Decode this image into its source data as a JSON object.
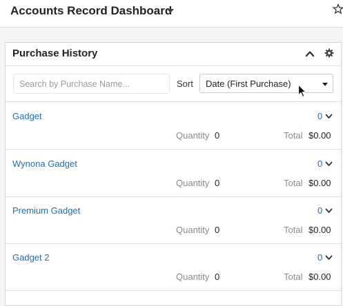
{
  "dashboard": {
    "title": "Accounts Record Dashboard"
  },
  "dashlet": {
    "title": "Purchase History"
  },
  "search": {
    "placeholder": "Search by Purchase Name..."
  },
  "sort": {
    "label": "Sort",
    "selected": "Date (First Purchase)"
  },
  "labels": {
    "quantity": "Quantity",
    "total": "Total"
  },
  "items": [
    {
      "name": "Gadget",
      "count": "0",
      "quantity": "0",
      "total": "$0.00"
    },
    {
      "name": "Wynona Gadget",
      "count": "0",
      "quantity": "0",
      "total": "$0.00"
    },
    {
      "name": "Premium Gadget",
      "count": "0",
      "quantity": "0",
      "total": "$0.00"
    },
    {
      "name": "Gadget 2",
      "count": "0",
      "quantity": "0",
      "total": "$0.00"
    }
  ],
  "colors": {
    "link": "#1b6fb8",
    "muted_text": "#8a8a8a",
    "border": "#e2e2e2"
  },
  "icons": {
    "dashboard_menu": "caret-down-icon",
    "favorite": "star-icon",
    "collapse": "chevron-up-icon",
    "settings": "gear-icon",
    "row_expand": "chevron-down-icon",
    "pointer": "cursor-icon"
  }
}
